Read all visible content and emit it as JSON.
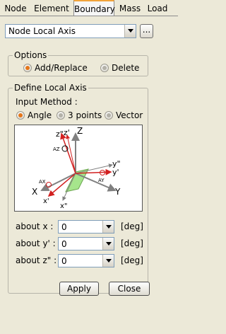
{
  "tabs": [
    "Node",
    "Element",
    "Boundary",
    "Mass",
    "Load"
  ],
  "active_tab": "Boundary",
  "function_select": {
    "value": "Node Local Axis"
  },
  "ellipsis_label": "...",
  "options": {
    "title": "Options",
    "add_replace": "Add/Replace",
    "delete": "Delete",
    "selected": "Add/Replace"
  },
  "define": {
    "title": "Define Local Axis",
    "input_method_label": "Input Method :",
    "methods": [
      "Angle",
      "3 points",
      "Vector"
    ],
    "selected_method": "Angle"
  },
  "diagram": {
    "labels": {
      "zpp": "z\"",
      "zp": "z'",
      "Z": "Z",
      "az": "AZ",
      "ypp": "y\"",
      "yp": "y'",
      "Y": "Y",
      "ay": "AY",
      "X": "X",
      "ax": "AX",
      "xp": "x'",
      "xpp": "x\""
    },
    "colors": {
      "local_axes": "#d22020",
      "global_axes": "#808080",
      "plane": "#a6e58c"
    }
  },
  "angles": [
    {
      "label": "about x :",
      "value": "0",
      "unit": "[deg]"
    },
    {
      "label": "about y' :",
      "value": "0",
      "unit": "[deg]"
    },
    {
      "label": "about z\" :",
      "value": "0",
      "unit": "[deg]"
    }
  ],
  "buttons": {
    "apply": "Apply",
    "close": "Close"
  }
}
